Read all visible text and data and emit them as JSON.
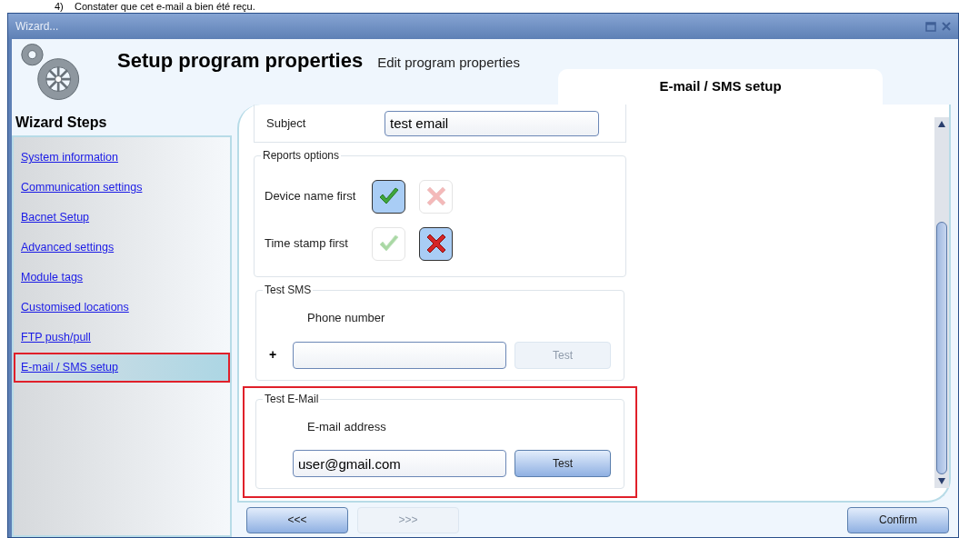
{
  "document_text": "4)    Constater que cet e-mail a bien été reçu.",
  "window": {
    "title": "Wizard..."
  },
  "header": {
    "title": "Setup program properties",
    "subtitle": "Edit program properties",
    "tab": "E-mail / SMS setup"
  },
  "sidebar": {
    "title": "Wizard Steps",
    "items": [
      {
        "label": "System information",
        "selected": false
      },
      {
        "label": "Communication settings",
        "selected": false
      },
      {
        "label": "Bacnet Setup",
        "selected": false
      },
      {
        "label": "Advanced settings",
        "selected": false
      },
      {
        "label": "Module tags",
        "selected": false
      },
      {
        "label": "Customised locations",
        "selected": false
      },
      {
        "label": "FTP push/pull",
        "selected": false
      },
      {
        "label": "E-mail / SMS setup",
        "selected": true,
        "highlighted": true
      }
    ]
  },
  "subject": {
    "label": "Subject",
    "value": "test email"
  },
  "reports_options": {
    "title": "Reports options",
    "rows": [
      {
        "label": "Device name first",
        "choices": [
          {
            "kind": "check",
            "selected": true
          },
          {
            "kind": "cross",
            "selected": false
          }
        ]
      },
      {
        "label": "Time stamp first",
        "choices": [
          {
            "kind": "check",
            "selected": false
          },
          {
            "kind": "cross",
            "selected": true
          }
        ]
      }
    ]
  },
  "test_sms": {
    "title": "Test SMS",
    "field_label": "Phone number",
    "prefix": "+",
    "button": {
      "label": "Test",
      "disabled": true
    }
  },
  "test_email": {
    "title": "Test E-Mail",
    "field_label": "E-mail address",
    "value": "user@gmail.com",
    "button": {
      "label": "Test",
      "disabled": false
    },
    "highlighted": true
  },
  "footer": {
    "buttons": [
      {
        "label": "<<<",
        "disabled": false
      },
      {
        "label": ">>>",
        "disabled": true
      },
      {
        "label": "Confirm",
        "disabled": false
      }
    ]
  }
}
